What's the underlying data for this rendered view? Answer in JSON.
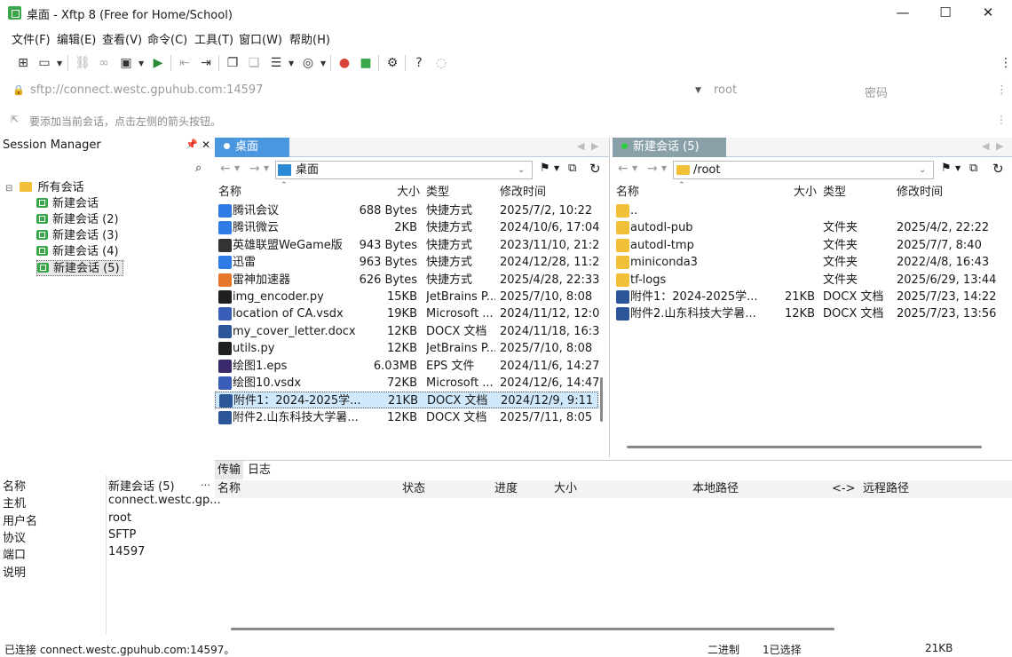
{
  "window": {
    "title": "桌面 - Xftp 8 (Free for Home/School)"
  },
  "menu": [
    "文件(F)",
    "编辑(E)",
    "查看(V)",
    "命令(C)",
    "工具(T)",
    "窗口(W)",
    "帮助(H)"
  ],
  "address": {
    "url": "sftp://connect.westc.gpuhub.com:14597",
    "user": "root",
    "password_placeholder": "密码"
  },
  "hint": "要添加当前会话，点击左侧的箭头按钮。",
  "session_manager": {
    "title": "Session Manager",
    "root": "所有会话",
    "items": [
      "新建会话",
      "新建会话 (2)",
      "新建会话 (3)",
      "新建会话 (4)",
      "新建会话 (5)"
    ]
  },
  "props": [
    {
      "k": "名称",
      "v": "新建会话 (5)"
    },
    {
      "k": "主机",
      "v": "connect.westc.gp..."
    },
    {
      "k": "用户名",
      "v": "root"
    },
    {
      "k": "协议",
      "v": "SFTP"
    },
    {
      "k": "端口",
      "v": "14597"
    },
    {
      "k": "说明",
      "v": ""
    }
  ],
  "left": {
    "tab": "桌面",
    "path": "桌面",
    "cols": [
      "名称",
      "大小",
      "类型",
      "修改时间"
    ],
    "files": [
      {
        "n": "腾讯会议",
        "s": "688 Bytes",
        "t": "快捷方式",
        "d": "2025/7/2, 10:22",
        "c": "#2f7be5"
      },
      {
        "n": "腾讯微云",
        "s": "2KB",
        "t": "快捷方式",
        "d": "2024/10/6, 17:04",
        "c": "#2f7be5"
      },
      {
        "n": "英雄联盟WeGame版",
        "s": "943 Bytes",
        "t": "快捷方式",
        "d": "2023/11/10, 21:2",
        "c": "#333"
      },
      {
        "n": "迅雷",
        "s": "963 Bytes",
        "t": "快捷方式",
        "d": "2024/12/28, 11:2",
        "c": "#2f7be5"
      },
      {
        "n": "雷神加速器",
        "s": "626 Bytes",
        "t": "快捷方式",
        "d": "2025/4/28, 22:33",
        "c": "#e8772e"
      },
      {
        "n": "img_encoder.py",
        "s": "15KB",
        "t": "JetBrains P...",
        "d": "2025/7/10, 8:08",
        "c": "#1f1f1f"
      },
      {
        "n": "location of CA.vsdx",
        "s": "19KB",
        "t": "Microsoft ...",
        "d": "2024/11/12, 12:0",
        "c": "#3a5db8"
      },
      {
        "n": "my_cover_letter.docx",
        "s": "12KB",
        "t": "DOCX 文档",
        "d": "2024/11/18, 16:3",
        "c": "#2b579a"
      },
      {
        "n": "utils.py",
        "s": "12KB",
        "t": "JetBrains P...",
        "d": "2025/7/10, 8:08",
        "c": "#1f1f1f"
      },
      {
        "n": "绘图1.eps",
        "s": "6.03MB",
        "t": "EPS 文件",
        "d": "2024/11/6, 14:27",
        "c": "#3a2a6b"
      },
      {
        "n": "绘图10.vsdx",
        "s": "72KB",
        "t": "Microsoft ...",
        "d": "2024/12/6, 14:47",
        "c": "#3a5db8"
      },
      {
        "n": "附件1：2024-2025学...",
        "s": "21KB",
        "t": "DOCX 文档",
        "d": "2024/12/9, 9:11",
        "c": "#2b579a"
      },
      {
        "n": "附件2.山东科技大学暑...",
        "s": "12KB",
        "t": "DOCX 文档",
        "d": "2025/7/11, 8:05",
        "c": "#2b579a"
      }
    ]
  },
  "right": {
    "tab": "新建会话 (5)",
    "path": "/root",
    "cols": [
      "名称",
      "大小",
      "类型",
      "修改时间"
    ],
    "files": [
      {
        "n": "..",
        "s": "",
        "t": "",
        "d": "",
        "c": "#f2c037"
      },
      {
        "n": "autodl-pub",
        "s": "",
        "t": "文件夹",
        "d": "2025/4/2, 22:22",
        "c": "#f2c037"
      },
      {
        "n": "autodl-tmp",
        "s": "",
        "t": "文件夹",
        "d": "2025/7/7, 8:40",
        "c": "#f2c037"
      },
      {
        "n": "miniconda3",
        "s": "",
        "t": "文件夹",
        "d": "2022/4/8, 16:43",
        "c": "#f2c037"
      },
      {
        "n": "tf-logs",
        "s": "",
        "t": "文件夹",
        "d": "2025/6/29, 13:44",
        "c": "#f2c037"
      },
      {
        "n": "附件1：2024-2025学...",
        "s": "21KB",
        "t": "DOCX 文档",
        "d": "2025/7/23, 14:22",
        "c": "#2b579a"
      },
      {
        "n": "附件2.山东科技大学暑...",
        "s": "12KB",
        "t": "DOCX 文档",
        "d": "2025/7/23, 13:56",
        "c": "#2b579a"
      }
    ]
  },
  "transfer": {
    "tabs": [
      "传输",
      "日志"
    ],
    "cols": [
      "名称",
      "状态",
      "进度",
      "大小",
      "本地路径",
      "<->",
      "远程路径"
    ]
  },
  "status": {
    "left": "已连接 connect.westc.gpuhub.com:14597。",
    "mode": "二进制",
    "selected": "1已选择",
    "size": "21KB"
  }
}
